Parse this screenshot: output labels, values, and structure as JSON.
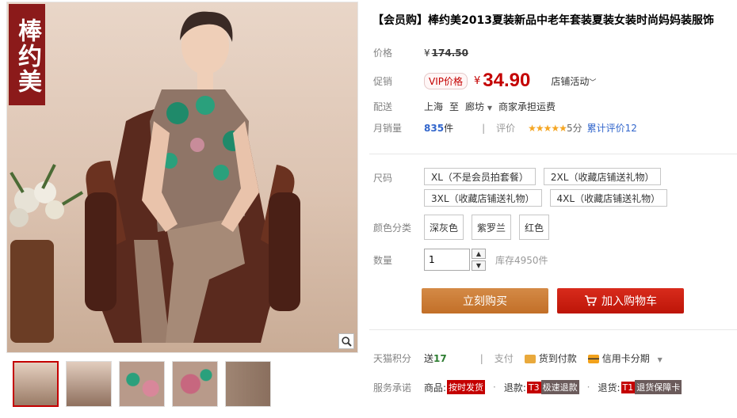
{
  "gallery": {
    "brand_tag": "棒约美",
    "zoom_icon": "magnifier-icon",
    "thumb_count": 5,
    "active_thumb": 1
  },
  "product": {
    "title": "【会员购】棒约美2013夏装新品中老年套装夏装女装时尚妈妈装服饰"
  },
  "price": {
    "label": "价格",
    "currency": "¥",
    "original": "174.50"
  },
  "promo": {
    "label": "促销",
    "vip_tag": "VIP价格",
    "currency": "¥",
    "value": "34.90",
    "store_activity": "店铺活动"
  },
  "shipping": {
    "label": "配送",
    "from": "上海",
    "to_word": "至",
    "to": "廊坊",
    "fee": "商家承担运费"
  },
  "sales": {
    "label": "月销量",
    "count": "835",
    "unit": "件",
    "rating_label": "评价",
    "stars": "★★★★★",
    "score": "5分",
    "reviews": "累计评价12"
  },
  "size": {
    "label": "尺码",
    "options": [
      "XL（不是会员拍套餐）",
      "2XL（收藏店铺送礼物）",
      "3XL（收藏店铺送礼物）",
      "4XL（收藏店铺送礼物）"
    ]
  },
  "color": {
    "label": "颜色分类",
    "options": [
      "深灰色",
      "紫罗兰",
      "红色"
    ]
  },
  "quantity": {
    "label": "数量",
    "value": "1",
    "up": "▲",
    "down": "▼",
    "stock": "库存4950件"
  },
  "actions": {
    "buy_now": "立刻购买",
    "add_cart": "加入购物车"
  },
  "points": {
    "label": "天猫积分",
    "prefix": "送",
    "value": "17",
    "pay_label": "支付",
    "cod": "货到付款",
    "installment": "信用卡分期"
  },
  "service": {
    "label": "服务承诺",
    "item1_prefix": "商品:",
    "item1_badge": "按时发货",
    "item2_prefix": "退款:",
    "item2_badge_code": "T3",
    "item2_badge": "极速退款",
    "item3_prefix": "退货:",
    "item3_badge_code": "T1",
    "item3_badge": "退货保障卡"
  },
  "colors": {
    "accent_red": "#c40000",
    "buy_orange": "#c67b36",
    "link_blue": "#3266cc",
    "brand_tag_bg": "#8b1a1a"
  }
}
